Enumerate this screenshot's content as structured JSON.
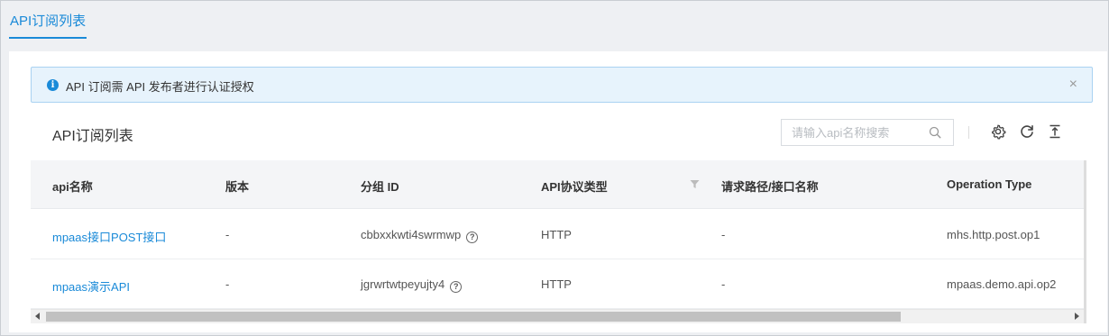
{
  "tabs": [
    {
      "label": "API订阅列表"
    }
  ],
  "alert": {
    "icon": "info-icon",
    "text": "API 订阅需 API 发布者进行认证授权",
    "close": "×"
  },
  "card": {
    "title": "API订阅列表"
  },
  "search": {
    "placeholder": "请输入api名称搜索"
  },
  "toolbar": {
    "icons": [
      "search-icon",
      "settings-icon",
      "refresh-icon",
      "export-icon"
    ]
  },
  "table": {
    "columns": [
      "api名称",
      "版本",
      "分组 ID",
      "API协议类型",
      "请求路径/接口名称",
      "Operation Type"
    ],
    "rows": [
      {
        "name": "mpaas接口POST接口",
        "version": "-",
        "group_id": "cbbxxkwti4swrmwp",
        "protocol": "HTTP",
        "path": "-",
        "operation_type": "mhs.http.post.op1"
      },
      {
        "name": "mpaas演示API",
        "version": "-",
        "group_id": "jgrwrtwtpeyujty4",
        "protocol": "HTTP",
        "path": "-",
        "operation_type": "mpaas.demo.api.op2"
      }
    ]
  },
  "colors": {
    "accent": "#1a8ad8",
    "alert_bg": "#e7f3fc",
    "header_bg": "#f4f5f7"
  }
}
